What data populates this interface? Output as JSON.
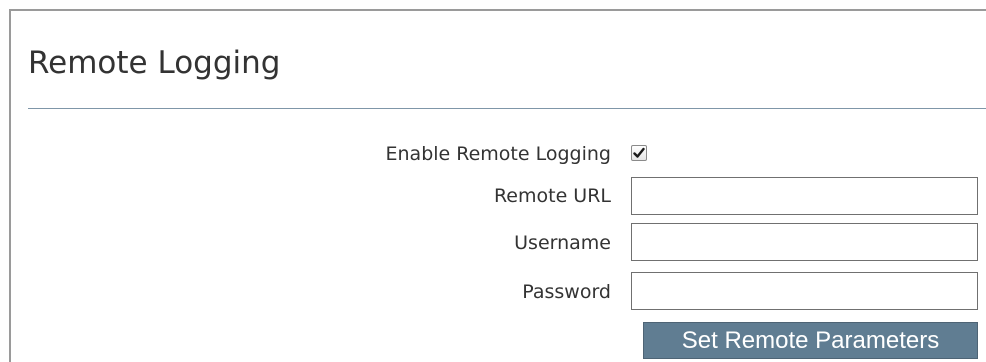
{
  "section": {
    "title": "Remote Logging"
  },
  "form": {
    "enable_label": "Enable Remote Logging",
    "enable_checked": true,
    "url_label": "Remote URL",
    "url_value": "",
    "username_label": "Username",
    "username_value": "",
    "password_label": "Password",
    "password_value": "",
    "submit_label": "Set Remote Parameters"
  },
  "colors": {
    "button_bg": "#607d92",
    "rule": "#7f96a8",
    "text": "#333333"
  },
  "icons": {
    "checkbox_mark": "checkmark-icon"
  }
}
